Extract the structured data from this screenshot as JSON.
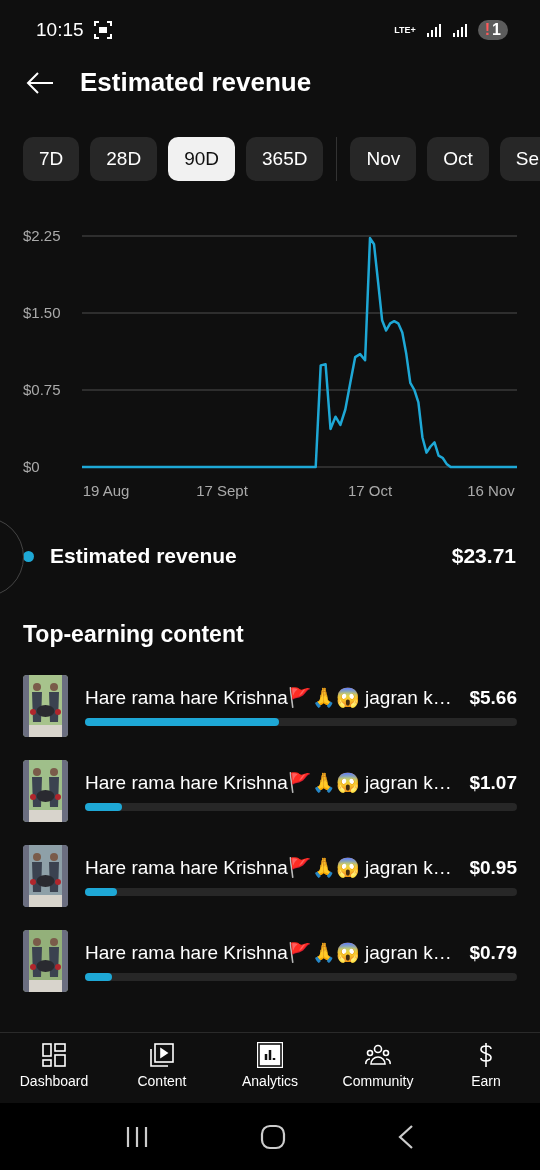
{
  "status_bar": {
    "time": "10:15",
    "network": "LTE+",
    "badge_mark": "!",
    "badge_count": "1"
  },
  "header": {
    "title": "Estimated revenue"
  },
  "ranges": [
    {
      "label": "7D",
      "selected": false
    },
    {
      "label": "28D",
      "selected": false
    },
    {
      "label": "90D",
      "selected": true
    },
    {
      "label": "365D",
      "selected": false
    },
    {
      "label": "Nov",
      "selected": false,
      "group_start": true
    },
    {
      "label": "Oct",
      "selected": false
    },
    {
      "label": "Se",
      "selected": false
    }
  ],
  "chart": {
    "chart_data": {
      "type": "line",
      "ylim": [
        0,
        2.25
      ],
      "yticks": [
        {
          "value": 0,
          "label": "$0"
        },
        {
          "value": 0.75,
          "label": "$0.75"
        },
        {
          "value": 1.5,
          "label": "$1.50"
        },
        {
          "value": 2.25,
          "label": "$2.25"
        }
      ],
      "categories": [
        "19 Aug",
        null,
        null,
        null,
        null,
        null,
        null,
        null,
        null,
        null,
        null,
        null,
        null,
        null,
        null,
        null,
        null,
        null,
        null,
        null,
        null,
        null,
        null,
        null,
        null,
        null,
        null,
        null,
        null,
        "17 Sept",
        null,
        null,
        null,
        null,
        null,
        null,
        null,
        null,
        null,
        null,
        null,
        null,
        null,
        null,
        null,
        null,
        null,
        null,
        null,
        null,
        null,
        null,
        null,
        null,
        null,
        null,
        null,
        null,
        null,
        "17 Oct",
        null,
        null,
        null,
        null,
        null,
        null,
        null,
        null,
        null,
        null,
        null,
        null,
        null,
        null,
        null,
        null,
        null,
        null,
        null,
        null,
        null,
        null,
        null,
        null,
        null,
        null,
        null,
        null,
        null,
        "16 Nov"
      ],
      "series": [
        {
          "name": "Estimated revenue",
          "color": "#1ea8d6",
          "values": [
            0,
            0,
            0,
            0,
            0,
            0,
            0,
            0,
            0,
            0,
            0,
            0,
            0,
            0,
            0,
            0,
            0,
            0,
            0,
            0,
            0,
            0,
            0,
            0,
            0,
            0,
            0,
            0,
            0,
            0,
            0,
            0,
            0,
            0,
            0,
            0,
            0,
            0,
            0,
            0,
            0,
            0,
            0,
            0,
            0,
            0,
            0,
            0,
            0,
            0.99,
            1.0,
            0.37,
            0.49,
            0.41,
            0.56,
            0.82,
            1.07,
            1.1,
            1.04,
            2.23,
            2.17,
            1.8,
            1.43,
            1.33,
            1.4,
            1.42,
            1.4,
            1.31,
            1.1,
            0.82,
            0.75,
            0.63,
            0.29,
            0.14,
            0.2,
            0.24,
            0.11,
            0.09,
            0.03,
            0,
            0,
            0,
            0,
            0,
            0,
            0,
            0,
            0,
            0,
            0
          ]
        }
      ]
    }
  },
  "summary": {
    "value": "$23.71"
  },
  "top_content": {
    "title": "Top-earning content",
    "items": [
      {
        "title": "Hare rama hare Krishna🚩🙏😱 jagran k…",
        "amount": "$5.66",
        "level": 0.45
      },
      {
        "title": "Hare rama hare Krishna🚩🙏😱 jagran k…",
        "amount": "$1.07",
        "level": 0.086
      },
      {
        "title": "Hare rama hare Krishna🚩🙏😱 jagran k…",
        "amount": "$0.95",
        "level": 0.074
      },
      {
        "title": "Hare rama hare Krishna🚩🙏😱 jagran k…",
        "amount": "$0.79",
        "level": 0.063
      }
    ]
  },
  "bottom_nav": [
    {
      "label": "Dashboard",
      "selected": false
    },
    {
      "label": "Content",
      "selected": false
    },
    {
      "label": "Analytics",
      "selected": true
    },
    {
      "label": "Community",
      "selected": false
    },
    {
      "label": "Earn",
      "selected": false
    }
  ]
}
